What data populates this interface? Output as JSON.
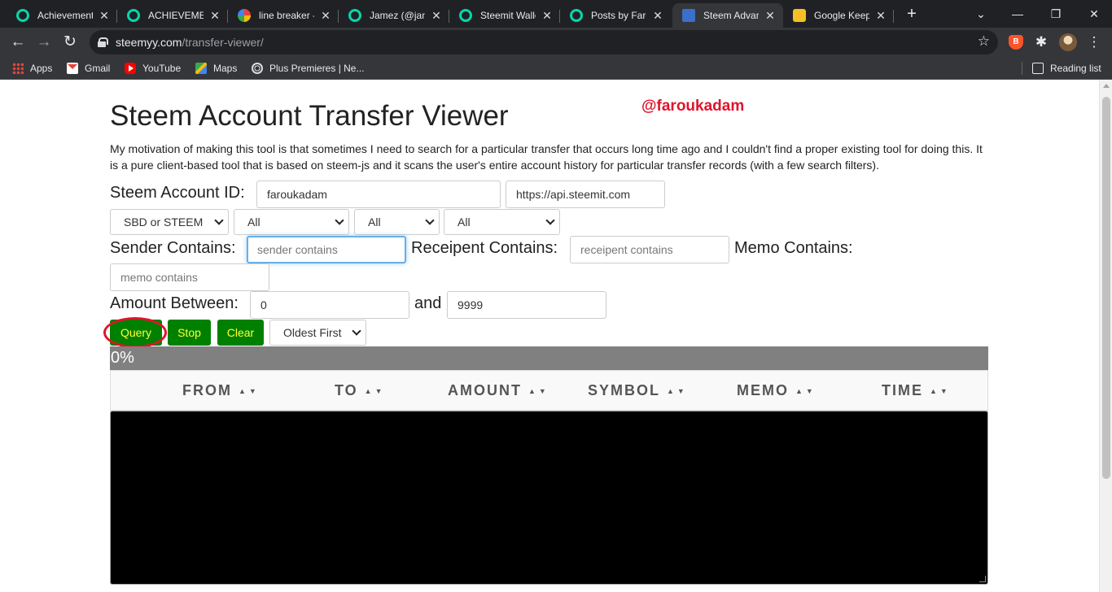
{
  "browser": {
    "tabs": [
      {
        "title": "Achievement",
        "icon": "steemit"
      },
      {
        "title": "ACHIEVEMEN",
        "icon": "steemit"
      },
      {
        "title": "line breaker -",
        "icon": "google"
      },
      {
        "title": "Jamez (@jam",
        "icon": "steemit"
      },
      {
        "title": "Steemit Walle",
        "icon": "steemit"
      },
      {
        "title": "Posts by Faro",
        "icon": "steemit"
      },
      {
        "title": "Steem Advan",
        "icon": "wp"
      },
      {
        "title": "Google Keep",
        "icon": "keep"
      }
    ],
    "tab_close_glyph": "✕",
    "new_tab_glyph": "+",
    "address": {
      "host": "steemyy.com",
      "path": "/transfer-viewer/"
    },
    "bookmarks": [
      "Apps",
      "Gmail",
      "YouTube",
      "Maps",
      "Plus Premieres | Ne..."
    ],
    "reading_list": "Reading list",
    "accent_steemit": "#07d6a9"
  },
  "page": {
    "title": "Steem Account Transfer Viewer",
    "handle": "@faroukadam",
    "intro": "My motivation of making this tool is that sometimes I need to search for a particular transfer that occurs long time ago and I couldn't find a proper existing tool for doing this. It is a pure client-based tool that is based on steem-js and it scans the user's entire account history for particular transfer records (with a few search filters).",
    "account": {
      "label": "Steem Account ID:",
      "value": "faroukadam",
      "api_node": "https://api.steemit.com"
    },
    "filters": {
      "currency": "SBD or STEEM",
      "filter2": "All",
      "filter3": "All",
      "filter4": "All"
    },
    "search": {
      "sender_label": "Sender Contains:",
      "sender_placeholder": "sender contains",
      "receipent_label": "Receipent Contains:",
      "receipent_placeholder": "receipent contains",
      "memo_label": "Memo Contains:",
      "memo_placeholder": "memo contains"
    },
    "amount": {
      "label": "Amount Between:",
      "min": "0",
      "and_label": "and",
      "max": "9999"
    },
    "buttons": {
      "query": "Query",
      "stop": "Stop",
      "clear": "Clear",
      "order": "Oldest First"
    },
    "progress": "0%",
    "columns": [
      "FROM",
      "TO",
      "AMOUNT",
      "SYMBOL",
      "MEMO",
      "TIME"
    ],
    "sort_glyph": "▲▼",
    "button_color": "#008000",
    "button_text_color": "#ffff33",
    "annotation_color": "#e0142b"
  }
}
